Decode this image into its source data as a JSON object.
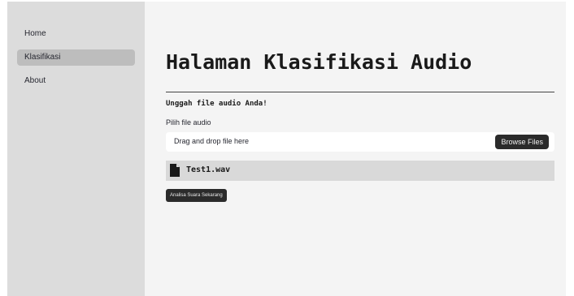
{
  "sidebar": {
    "items": [
      {
        "label": "Home"
      },
      {
        "label": "Klasifikasi"
      },
      {
        "label": "About"
      }
    ]
  },
  "main": {
    "title": "Halaman Klasifikasi Audio",
    "subheading": "Unggah file audio Anda!",
    "uploader": {
      "label": "Pilih file audio",
      "dropzone_text": "Drag and drop file here",
      "browse_label": "Browse Files"
    },
    "uploaded_file": {
      "name": "Test1.wav",
      "icon": "file-icon"
    },
    "analyze_label": "Analisa Suara Sekarang"
  },
  "colors": {
    "sidebar_bg": "#dcdcdc",
    "main_bg": "#f4f4f4",
    "active_item_bg": "#bdbdbd",
    "button_bg": "#2b2b2b"
  }
}
